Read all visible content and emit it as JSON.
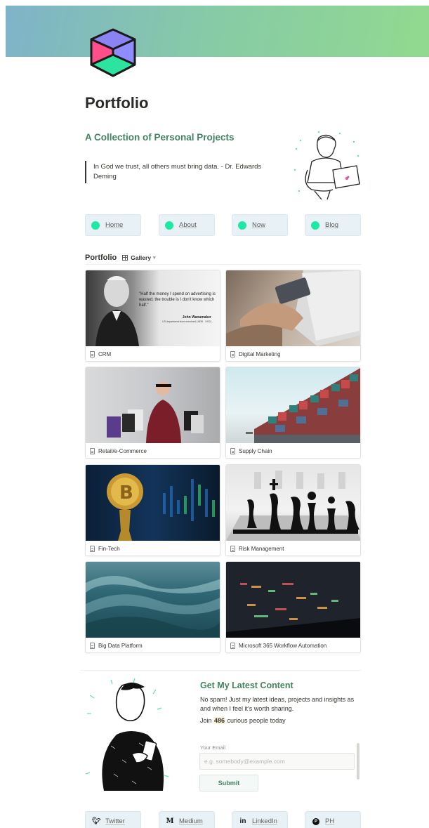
{
  "page": {
    "title": "Portfolio",
    "subtitle": "A Collection of Personal Projects",
    "quote": "In God we trust, all others must bring data. - Dr. Edwards Deming"
  },
  "nav": [
    {
      "label": "Home"
    },
    {
      "label": "About"
    },
    {
      "label": "Now"
    },
    {
      "label": "Blog"
    }
  ],
  "gallery": {
    "title": "Portfolio",
    "view_label": "Gallery",
    "cards": [
      {
        "label": "CRM",
        "image_text": {
          "quote": "\"Half the money I spend on advertising is wasted; the trouble is I don't know which half.\"",
          "author": "John Wanamaker",
          "author_note": "US department store merchant (1838 - 1922)"
        }
      },
      {
        "label": "Digital Marketing"
      },
      {
        "label": "Retail/e-Commerce"
      },
      {
        "label": "Supply Chain"
      },
      {
        "label": "Fin-Tech"
      },
      {
        "label": "Risk Management"
      },
      {
        "label": "Big Data Platform"
      },
      {
        "label": "Microsoft 365 Workflow Automation"
      }
    ]
  },
  "newsletter": {
    "title": "Get My Latest Content",
    "text": "No spam! Just my latest ideas, projects and insights as and when I feel it's worth sharing.",
    "join_prefix": "Join ",
    "join_count": "486",
    "join_suffix": " curious people today",
    "email_label": "Your Email",
    "email_placeholder": "e.g. somebody@example.com",
    "submit_label": "Submit"
  },
  "social": [
    {
      "label": "Twitter",
      "icon": "twitter-icon"
    },
    {
      "label": "Medium",
      "icon": "medium-icon"
    },
    {
      "label": "LinkedIn",
      "icon": "linkedin-icon"
    },
    {
      "label": "PH",
      "icon": "product-hunt-icon"
    }
  ],
  "colors": {
    "accent_green": "#448361",
    "nav_dot": "#1de9a5",
    "button_bg": "#e8f1f6"
  }
}
